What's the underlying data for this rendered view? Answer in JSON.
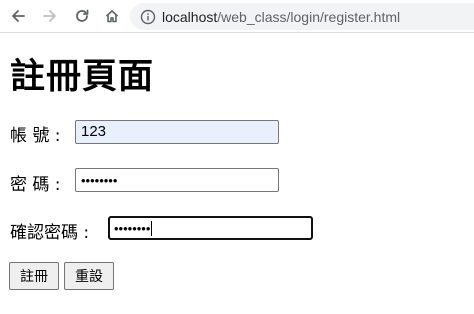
{
  "browser": {
    "url_host": "localhost",
    "url_path": "/web_class/login/register.html",
    "icons": [
      "back-arrow-icon",
      "forward-arrow-icon",
      "reload-icon",
      "home-icon",
      "info-icon"
    ]
  },
  "page": {
    "title": "註冊頁面"
  },
  "form": {
    "account": {
      "label": "帳 號 :",
      "value": "123"
    },
    "password": {
      "label": "密 碼 :",
      "value": "••••••••"
    },
    "confirm": {
      "label": "確認密碼 :",
      "value": "••••••••"
    },
    "submit_label": "註冊",
    "reset_label": "重設"
  },
  "colors": {
    "autofill_bg": "#e8f0fe",
    "url_bar_bg": "#f1f3f4"
  }
}
